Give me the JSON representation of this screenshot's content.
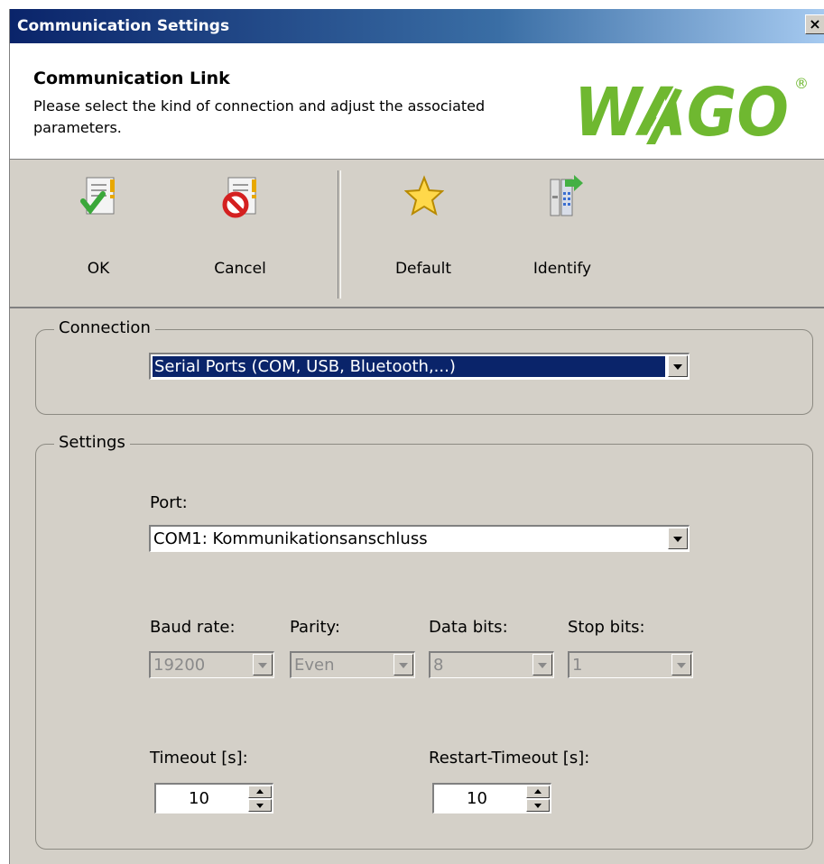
{
  "window": {
    "title": "Communication Settings",
    "close_glyph": "×"
  },
  "header": {
    "title": "Communication Link",
    "description": "Please select the kind of connection and adjust the associated parameters.",
    "logo_text": "WAGO",
    "logo_registered": "®",
    "logo_color": "#6fb830"
  },
  "toolbar": {
    "buttons": [
      {
        "label": "OK",
        "icon": "ok-check-icon"
      },
      {
        "label": "Cancel",
        "icon": "cancel-icon"
      },
      {
        "label": "Default",
        "icon": "star-icon"
      },
      {
        "label": "Identify",
        "icon": "identify-icon"
      }
    ]
  },
  "connection": {
    "group_title": "Connection",
    "selected": "Serial Ports (COM, USB, Bluetooth,...)"
  },
  "settings": {
    "group_title": "Settings",
    "port_label": "Port:",
    "port_value": "COM1: Kommunikationsanschluss",
    "baud_label": "Baud rate:",
    "baud_value": "19200",
    "parity_label": "Parity:",
    "parity_value": "Even",
    "databits_label": "Data bits:",
    "databits_value": "8",
    "stopbits_label": "Stop bits:",
    "stopbits_value": "1",
    "timeout_label": "Timeout [s]:",
    "timeout_value": "10",
    "restart_label": "Restart-Timeout [s]:",
    "restart_value": "10"
  }
}
